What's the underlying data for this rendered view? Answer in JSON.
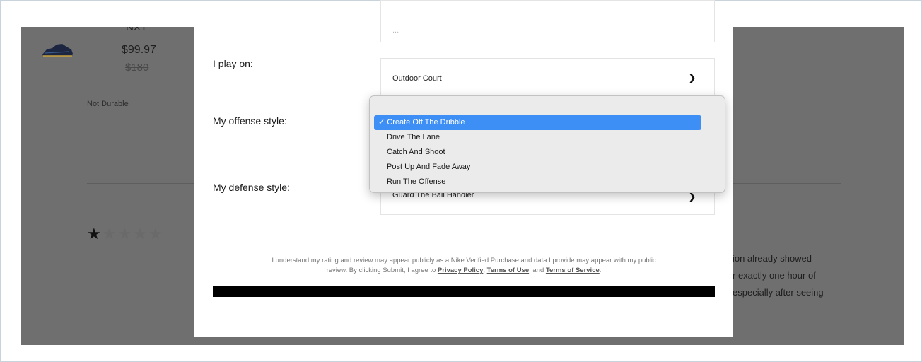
{
  "background": {
    "product_name": "NXT",
    "price": "$99.97",
    "original_price": "$180",
    "tag": "Not Durable",
    "rating_stars": 1,
    "rating_max": 5,
    "review_snippet": [
      "ion already showed",
      "r exactly one hour of",
      "especially after seeing"
    ]
  },
  "modal": {
    "top_field_placeholder": "...",
    "play_on": {
      "label": "I play on:",
      "value": "Outdoor Court"
    },
    "offense": {
      "label": "My offense style:"
    },
    "defense": {
      "label": "My defense style:",
      "value": "Guard The Ball Handler"
    },
    "disclaimer": {
      "line1": "I understand my rating and review may appear publicly as a Nike Verified Purchase and data I provide may appear with my public",
      "line2_prefix": "review. By clicking Submit, I agree to ",
      "privacy": "Privacy Policy",
      "sep1": ", ",
      "terms_use": "Terms of Use",
      "sep2": ", and ",
      "terms_service": "Terms of Service",
      "end": "."
    }
  },
  "dropdown": {
    "selected": "✓ Create Off The Dribble",
    "options": [
      "Drive The Lane",
      "Catch And Shoot",
      "Post Up And Fade Away",
      "Run The Offense"
    ]
  },
  "icons": {
    "chevron": "chevron-down-icon",
    "star": "star-icon"
  }
}
